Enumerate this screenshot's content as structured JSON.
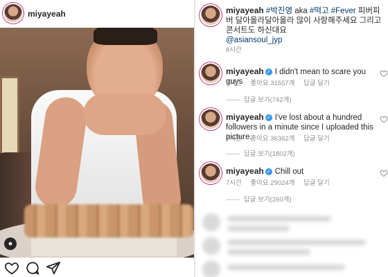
{
  "post": {
    "username": "miyayeah"
  },
  "caption": {
    "username": "miyayeah",
    "hashtag1": "#박진영",
    "aka": " aka ",
    "hashtag2": "#떡고",
    "hashtag3": "#Fever",
    "text": " 피버피버 달아올라달아올라 많이 사랑해주세요 그리고 콘서트도 하신대요",
    "mention": "@asiansoul_jyp",
    "time": "8시간"
  },
  "comments": [
    {
      "username": "miyayeah",
      "text": "I didn't mean to scare you guys",
      "time": "7시간",
      "likes": "좋아요 31557개",
      "reply": "답글 달기",
      "view_replies": "답글 보기(742개)"
    },
    {
      "username": "miyayeah",
      "text": "I've lost about a hundred followers in a minute since I uploaded this picture.",
      "time": "7시간",
      "likes": "좋아요 36362개",
      "reply": "답글 달기",
      "view_replies": "답글 보기(1802개)"
    },
    {
      "username": "miyayeah",
      "text": "Chill out",
      "time": "7시간",
      "likes": "좋아요 29024개",
      "reply": "답글 달기",
      "view_replies": "답글 보기(260개)"
    }
  ],
  "icons": {
    "like": "heart-icon",
    "comment": "comment-icon",
    "share": "share-icon",
    "user_tag": "user-tag-icon",
    "verified": "verified-badge-icon"
  },
  "colors": {
    "link": "#00376b",
    "meta": "#8e8e8e",
    "verified": "#3897f0"
  }
}
